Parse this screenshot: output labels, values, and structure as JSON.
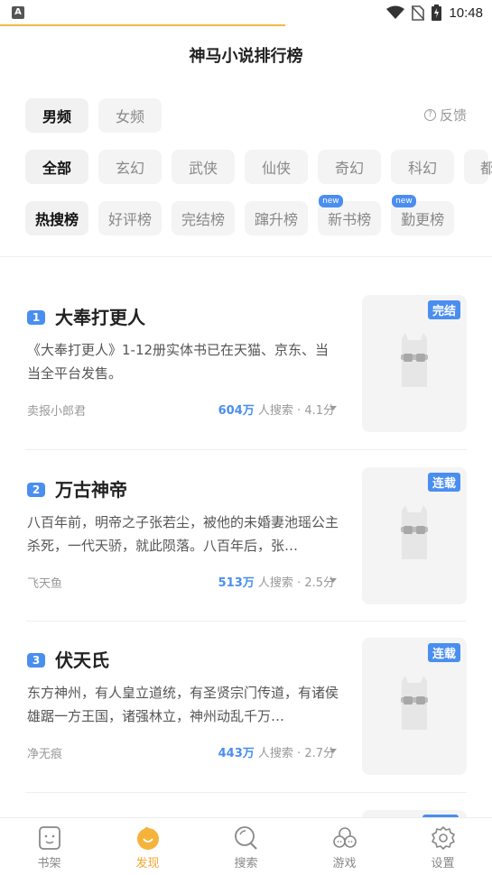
{
  "status_bar": {
    "time": "10:48",
    "left_icon": "A"
  },
  "header": {
    "title": "神马小说排行榜"
  },
  "gender_tabs": [
    {
      "label": "男频",
      "active": true
    },
    {
      "label": "女频",
      "active": false
    }
  ],
  "feedback": {
    "label": "反馈",
    "icon": "question-circle-icon"
  },
  "category_tabs": [
    {
      "label": "全部",
      "active": true
    },
    {
      "label": "玄幻",
      "active": false
    },
    {
      "label": "武侠",
      "active": false
    },
    {
      "label": "仙侠",
      "active": false
    },
    {
      "label": "奇幻",
      "active": false
    },
    {
      "label": "科幻",
      "active": false
    },
    {
      "label": "都",
      "active": false
    }
  ],
  "ranking_tabs": [
    {
      "label": "热搜榜",
      "active": true,
      "badge": ""
    },
    {
      "label": "好评榜",
      "active": false,
      "badge": ""
    },
    {
      "label": "完结榜",
      "active": false,
      "badge": ""
    },
    {
      "label": "蹿升榜",
      "active": false,
      "badge": ""
    },
    {
      "label": "新书榜",
      "active": false,
      "badge": "new"
    },
    {
      "label": "勤更榜",
      "active": false,
      "badge": "new"
    }
  ],
  "books": [
    {
      "rank": "1",
      "title": "大奉打更人",
      "description": "《大奉打更人》1-12册实体书已在天猫、京东、当当全平台发售。",
      "author": "卖报小郎君",
      "searches": "604万",
      "searches_suffix": "人搜索 · 4.1分",
      "status": "完结"
    },
    {
      "rank": "2",
      "title": "万古神帝",
      "description": "八百年前，明帝之子张若尘，被他的未婚妻池瑶公主杀死，一代天骄，就此陨落。八百年后，张…",
      "author": "飞天鱼",
      "searches": "513万",
      "searches_suffix": "人搜索 · 2.5分",
      "status": "连载"
    },
    {
      "rank": "3",
      "title": "伏天氏",
      "description": "东方神州，有人皇立道统，有圣贤宗门传道，有诸侯雄踞一方王国，诸强林立，神州动乱千万…",
      "author": "净无痕",
      "searches": "443万",
      "searches_suffix": "人搜索 · 2.7分",
      "status": "连载"
    }
  ],
  "bottom_nav": [
    {
      "label": "书架",
      "icon": "bookshelf-icon",
      "active": false
    },
    {
      "label": "发现",
      "icon": "discover-icon",
      "active": true
    },
    {
      "label": "搜索",
      "icon": "search-icon",
      "active": false
    },
    {
      "label": "游戏",
      "icon": "game-icon",
      "active": false
    },
    {
      "label": "设置",
      "icon": "settings-icon",
      "active": false
    }
  ],
  "colors": {
    "accent_blue": "#4a8ef0",
    "accent_orange": "#f3a733",
    "chip_bg": "#f4f4f4"
  }
}
